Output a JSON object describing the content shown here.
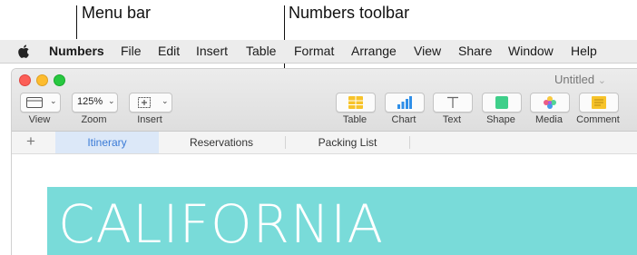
{
  "callouts": {
    "menu_bar": "Menu bar",
    "toolbar": "Numbers toolbar"
  },
  "menu": {
    "apple_icon": "apple-icon",
    "app": "Numbers",
    "items": [
      "File",
      "Edit",
      "Insert",
      "Table",
      "Format",
      "Arrange",
      "View",
      "Share",
      "Window",
      "Help"
    ]
  },
  "window": {
    "title": "Untitled",
    "title_chevron": "⌄"
  },
  "toolbar": {
    "left": [
      {
        "label": "View",
        "icon": "sidebar-icon"
      },
      {
        "label": "Zoom",
        "value": "125%"
      },
      {
        "label": "Insert",
        "icon": "insert-plus-icon"
      }
    ],
    "right": [
      {
        "label": "Table",
        "icon": "table-icon",
        "color": "#f7c32a"
      },
      {
        "label": "Chart",
        "icon": "bar-chart-icon",
        "color": "#2f8fe8"
      },
      {
        "label": "Text",
        "icon": "text-icon",
        "color": "#666666"
      },
      {
        "label": "Shape",
        "icon": "shape-square-icon",
        "color": "#3fcf8a"
      },
      {
        "label": "Media",
        "icon": "photos-flower-icon",
        "color": "#e94b7a"
      },
      {
        "label": "Comment",
        "icon": "comment-note-icon",
        "color": "#f7c32a"
      }
    ]
  },
  "tabs": {
    "add": "+",
    "items": [
      "Itinerary",
      "Reservations",
      "Packing List"
    ],
    "active_index": 0
  },
  "sheet": {
    "banner_text": "CALIFORNIA",
    "banner_color": "#79dbd9"
  }
}
